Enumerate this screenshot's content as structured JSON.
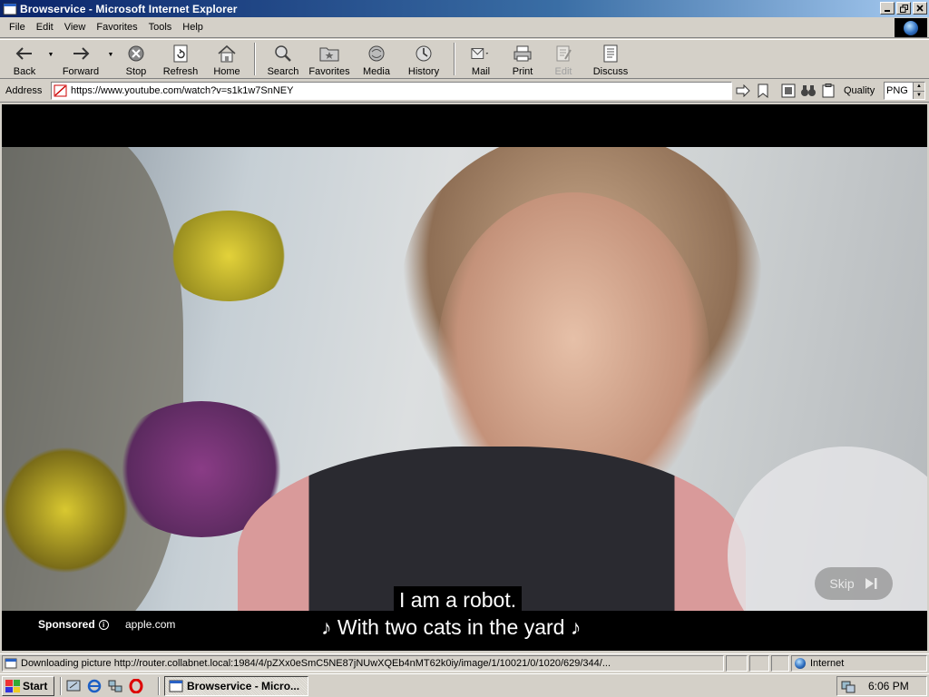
{
  "window": {
    "title": "Browservice - Microsoft Internet Explorer"
  },
  "menu": [
    {
      "label": "File"
    },
    {
      "label": "Edit"
    },
    {
      "label": "View"
    },
    {
      "label": "Favorites"
    },
    {
      "label": "Tools"
    },
    {
      "label": "Help"
    }
  ],
  "toolbar": {
    "back": "Back",
    "forward": "Forward",
    "stop": "Stop",
    "refresh": "Refresh",
    "home": "Home",
    "search": "Search",
    "favorites": "Favorites",
    "media": "Media",
    "history": "History",
    "mail": "Mail",
    "print": "Print",
    "edit": "Edit",
    "discuss": "Discuss"
  },
  "address": {
    "label": "Address",
    "url": "https://www.youtube.com/watch?v=s1k1w7SnNEY",
    "quality_label": "Quality",
    "quality_value": "PNG"
  },
  "video": {
    "skip_label": "Skip",
    "caption_line1": "I am a robot.",
    "caption_line2": "♪ With two cats in the yard ♪",
    "sponsored_label": "Sponsored",
    "advertiser": "apple.com"
  },
  "status": {
    "text": "Downloading picture http://router.collabnet.local:1984/4/pZXx0eSmC5NE87jNUwXQEb4nMT62k0iy/image/1/10021/0/1020/629/344/...",
    "zone": "Internet"
  },
  "taskbar": {
    "start": "Start",
    "task": "Browservice - Micro...",
    "clock": "6:06 PM"
  },
  "colors": {
    "title_bar": "#0a246a",
    "chrome": "#d4d0c8",
    "video_bg": "#000000"
  }
}
